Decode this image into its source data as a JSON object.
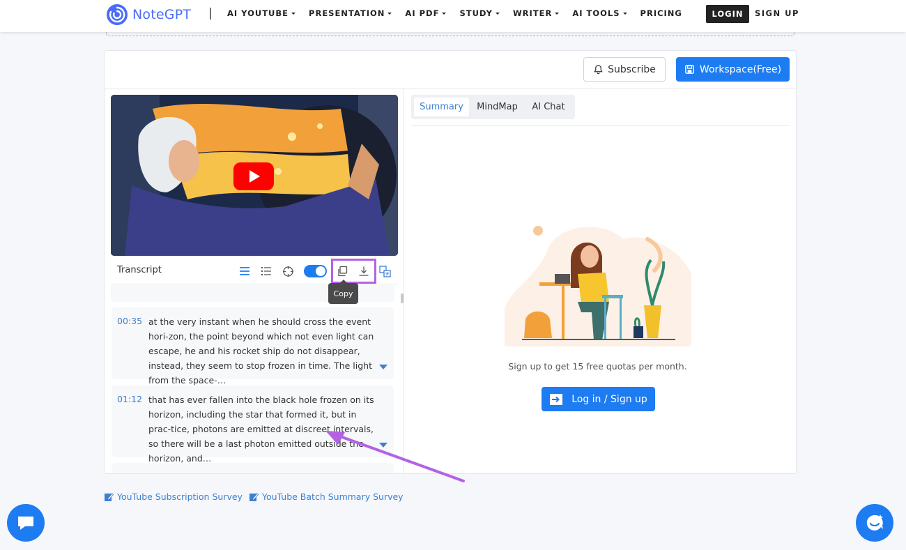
{
  "brand": {
    "name": "NoteGPT"
  },
  "nav": {
    "separator": "|",
    "items": [
      {
        "label": "AI YOUTUBE",
        "has_caret": true
      },
      {
        "label": "PRESENTATION",
        "has_caret": true
      },
      {
        "label": "AI PDF",
        "has_caret": true
      },
      {
        "label": "STUDY",
        "has_caret": true
      },
      {
        "label": "WRITER",
        "has_caret": true
      },
      {
        "label": "AI TOOLS",
        "has_caret": true
      },
      {
        "label": "PRICING",
        "has_caret": false
      }
    ],
    "login_label": "LOGIN",
    "signup_label": "SIGN UP"
  },
  "header_actions": {
    "subscribe_label": "Subscribe",
    "workspace_label": "Workspace(Free)"
  },
  "transcript": {
    "label": "Transcript",
    "toolbar_icons": [
      "list-icon",
      "bulleted-list-icon",
      "crosshair-icon",
      "toggle-switch",
      "copy-icon",
      "download-icon",
      "translate-icon"
    ],
    "toggle_on": true,
    "tooltip": "Copy",
    "segments": [
      {
        "time": "00:35",
        "text": "at the very instant when he should cross the event hori-zon, the point beyond which not even light can escape, he and his rocket ship do not disappear, instead, they seem to stop frozen in time. The light from the space-…"
      },
      {
        "time": "01:12",
        "text": "that has ever fallen into the black hole frozen on its horizon, including the star that formed it, but in prac-tice, photons are emitted at discreet intervals, so there will be a last photon emitted outside the horizon, and…"
      }
    ]
  },
  "right_panel": {
    "tabs": [
      {
        "label": "Summary",
        "active": true
      },
      {
        "label": "MindMap",
        "active": false
      },
      {
        "label": "AI Chat",
        "active": false
      }
    ],
    "quota_text": "Sign up to get 15 free quotas per month.",
    "cta_label": "Log in / Sign up"
  },
  "footer_links": [
    {
      "label": "YouTube Subscription Survey"
    },
    {
      "label": "YouTube Batch Summary Survey"
    }
  ],
  "colors": {
    "accent": "#1e7cf2",
    "highlight": "#b462e3",
    "link": "#3d7fd1",
    "youtube_red": "#ff0000"
  }
}
